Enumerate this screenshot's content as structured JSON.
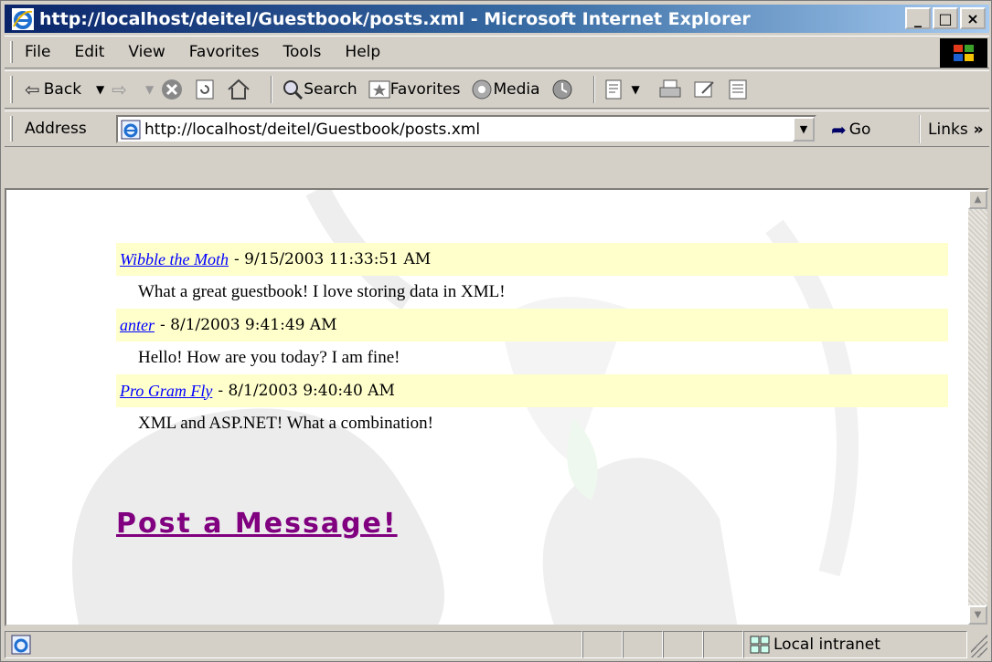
{
  "window": {
    "title": "http://localhost/deitel/Guestbook/posts.xml - Microsoft Internet Explorer",
    "controls": [
      "_",
      "□",
      "×"
    ]
  },
  "menu": [
    "File",
    "Edit",
    "View",
    "Favorites",
    "Tools",
    "Help"
  ],
  "toolbar": {
    "back": "Back",
    "search": "Search",
    "favorites": "Favorites",
    "media": "Media"
  },
  "address": {
    "label": "Address",
    "url": "http://localhost/deitel/Guestbook/posts.xml",
    "go": "Go",
    "links": "Links",
    "links_more": "»"
  },
  "posts": [
    {
      "author": "Wibble the Moth",
      "date": "9/15/2003 11:33:51 AM",
      "message": "What a great guestbook! I love storing data in XML!"
    },
    {
      "author": "anter",
      "date": "8/1/2003 9:41:49 AM",
      "message": "Hello! How are you today? I am fine!"
    },
    {
      "author": "Pro Gram Fly",
      "date": "8/1/2003 9:40:40 AM",
      "message": "XML and ASP.NET! What a combination!"
    }
  ],
  "post_link": "Post a Message!",
  "status": {
    "zone": "Local intranet"
  },
  "colors": {
    "titlebar_start": "#0a246a",
    "post_header_bg": "#ffffcc",
    "author_link": "#0000ff",
    "post_link": "#800080"
  }
}
